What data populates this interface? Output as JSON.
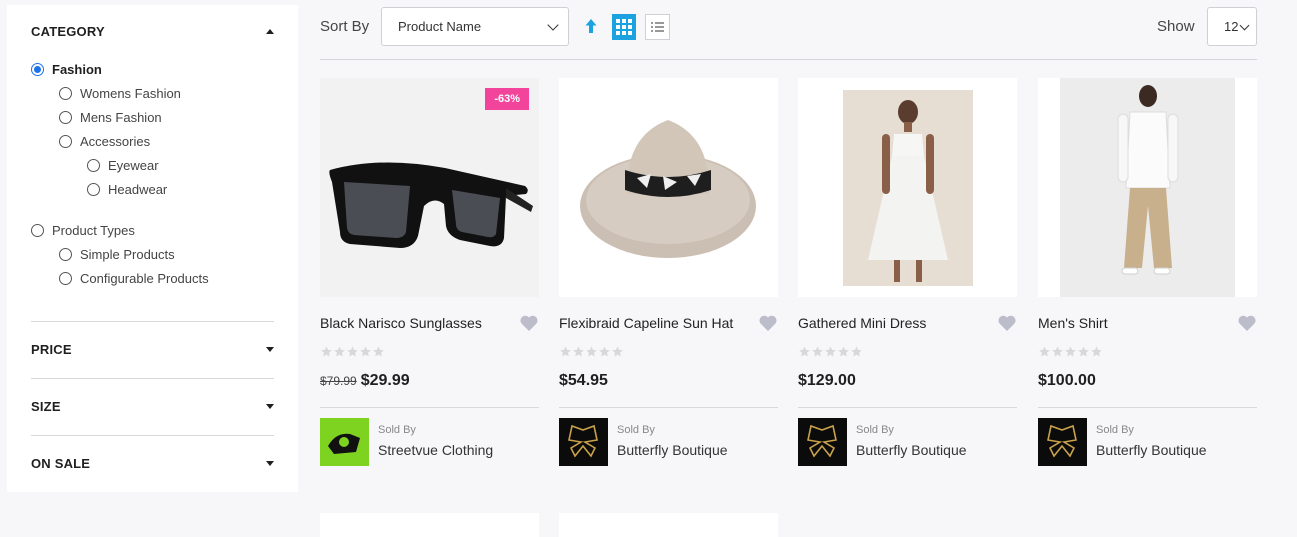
{
  "sidebar": {
    "category": {
      "title": "CATEGORY",
      "options": [
        {
          "label": "Fashion",
          "checked": true
        },
        {
          "label": "Womens Fashion"
        },
        {
          "label": "Mens Fashion"
        },
        {
          "label": "Accessories"
        },
        {
          "label": "Eyewear"
        },
        {
          "label": "Headwear"
        },
        {
          "label": "Product Types"
        },
        {
          "label": "Simple Products"
        },
        {
          "label": "Configurable Products"
        }
      ]
    },
    "price": {
      "title": "PRICE"
    },
    "size": {
      "title": "SIZE"
    },
    "on_sale": {
      "title": "ON SALE"
    }
  },
  "toolbar": {
    "sort_label": "Sort By",
    "sort_value": "Product Name",
    "show_label": "Show",
    "show_value": "12"
  },
  "colors": {
    "accent": "#1aa3e0",
    "badge": "#f1449a",
    "heart": "#bdbccb",
    "star": "#d8d8d8"
  },
  "products": [
    {
      "name": "Black Narisco Sunglasses",
      "badge": "-63%",
      "old_price": "$79.99",
      "price": "$29.99",
      "sold_by": "Sold By",
      "seller": "Streetvue Clothing",
      "rating": 0
    },
    {
      "name": "Flexibraid Capeline Sun Hat",
      "price": "$54.95",
      "sold_by": "Sold By",
      "seller": "Butterfly Boutique",
      "rating": 0
    },
    {
      "name": "Gathered Mini Dress",
      "price": "$129.00",
      "sold_by": "Sold By",
      "seller": "Butterfly Boutique",
      "rating": 0
    },
    {
      "name": "Men's Shirt",
      "price": "$100.00",
      "sold_by": "Sold By",
      "seller": "Butterfly Boutique",
      "rating": 0
    }
  ],
  "icons": {
    "sort_direction": "arrow-up-icon",
    "grid_view": "grid-view-icon",
    "list_view": "list-view-icon",
    "wishlist": "heart-icon",
    "rating": "star-icon"
  }
}
